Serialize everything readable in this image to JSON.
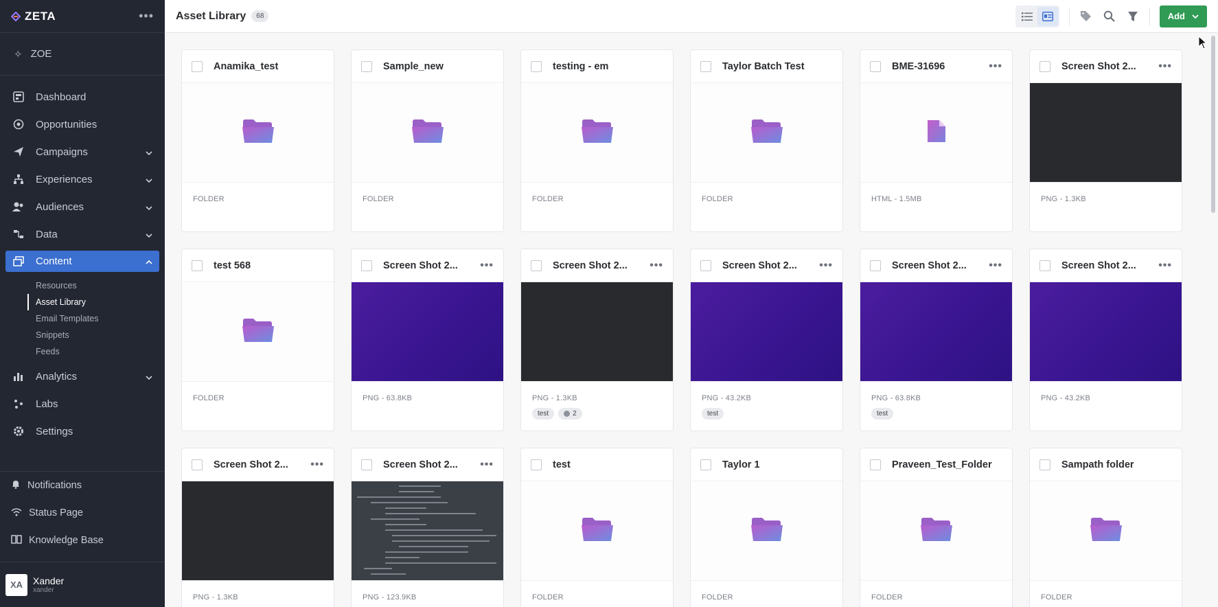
{
  "app": {
    "name": "ZETA",
    "assistant": "ZOE"
  },
  "nav": {
    "items": [
      {
        "label": "Dashboard"
      },
      {
        "label": "Opportunities"
      },
      {
        "label": "Campaigns"
      },
      {
        "label": "Experiences"
      },
      {
        "label": "Audiences"
      },
      {
        "label": "Data"
      },
      {
        "label": "Content"
      },
      {
        "label": "Analytics"
      },
      {
        "label": "Labs"
      },
      {
        "label": "Settings"
      }
    ],
    "content_sub": [
      "Resources",
      "Asset Library",
      "Email Templates",
      "Snippets",
      "Feeds"
    ]
  },
  "bottom": {
    "notifications": "Notifications",
    "status": "Status Page",
    "kb": "Knowledge Base"
  },
  "user": {
    "initials": "XA",
    "name": "Xander",
    "handle": "xander"
  },
  "header": {
    "title": "Asset Library",
    "count": "68",
    "add_label": "Add"
  },
  "cards": [
    {
      "title": "Anamika_test",
      "meta": "FOLDER"
    },
    {
      "title": "Sample_new",
      "meta": "FOLDER"
    },
    {
      "title": "testing - em",
      "meta": "FOLDER"
    },
    {
      "title": "Taylor Batch Test",
      "meta": "FOLDER"
    },
    {
      "title": "BME-31696",
      "meta": "HTML - 1.5MB"
    },
    {
      "title": "Screen Shot 2...",
      "meta": "PNG - 1.3KB"
    },
    {
      "title": "test 568",
      "meta": "FOLDER"
    },
    {
      "title": "Screen Shot 2...",
      "meta": "PNG - 63.8KB"
    },
    {
      "title": "Screen Shot 2...",
      "meta": "PNG - 1.3KB",
      "tags": [
        "test",
        "2"
      ]
    },
    {
      "title": "Screen Shot 2...",
      "meta": "PNG - 43.2KB",
      "tags": [
        "test"
      ]
    },
    {
      "title": "Screen Shot 2...",
      "meta": "PNG - 63.8KB",
      "tags": [
        "test"
      ]
    },
    {
      "title": "Screen Shot 2...",
      "meta": "PNG - 43.2KB"
    },
    {
      "title": "Screen Shot 2...",
      "meta": "PNG - 1.3KB"
    },
    {
      "title": "Screen Shot 2...",
      "meta": "PNG - 123.9KB"
    },
    {
      "title": "test",
      "meta": "FOLDER"
    },
    {
      "title": "Taylor 1",
      "meta": "FOLDER"
    },
    {
      "title": "Praveen_Test_Folder",
      "meta": "FOLDER"
    },
    {
      "title": "Sampath folder",
      "meta": "FOLDER"
    }
  ],
  "colors": {
    "sidebar": "#232732",
    "active": "#3b6fd0",
    "add": "#2f9b55",
    "purple": "#3a1591"
  }
}
